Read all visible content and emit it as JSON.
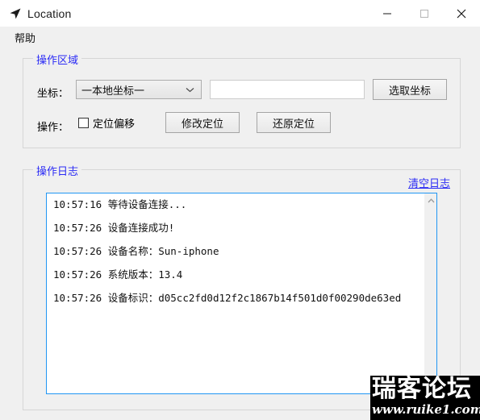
{
  "window": {
    "title": "Location",
    "icon": "navigation-arrow-icon",
    "controls": {
      "minimize": "minimize-icon",
      "maximize": "maximize-icon",
      "close": "close-icon"
    }
  },
  "menubar": {
    "items": [
      {
        "label": "帮助"
      }
    ]
  },
  "operation_group": {
    "legend": "操作区域",
    "coord_label": "坐标：",
    "coord_select": {
      "value": "一本地坐标一",
      "arrow": "chevron-down-icon"
    },
    "coord_input": {
      "value": "",
      "placeholder": ""
    },
    "pick_button": "选取坐标",
    "operation_label": "操作：",
    "offset_checkbox": {
      "label": "定位偏移",
      "checked": false
    },
    "modify_button": "修改定位",
    "restore_button": "还原定位"
  },
  "log_group": {
    "legend": "操作日志",
    "clear_link": "清空日志",
    "lines": [
      "10:57:16 等待设备连接...",
      "10:57:26 设备连接成功!",
      "10:57:26 设备名称：Sun-iphone",
      "10:57:26 系统版本：13.4",
      "10:57:26 设备标识：d05cc2fd0d12f2c1867b14f501d0f00290de63ed"
    ],
    "scrollbar": {
      "up_arrow": "chevron-up-icon",
      "down_arrow": "chevron-down-icon"
    }
  },
  "watermark": {
    "main": "瑞客论坛",
    "sub": "www.ruike1.com"
  },
  "colors": {
    "accent_blue": "#2b2bf5",
    "log_border": "#2196f3",
    "client_bg": "#f0f0f0"
  }
}
